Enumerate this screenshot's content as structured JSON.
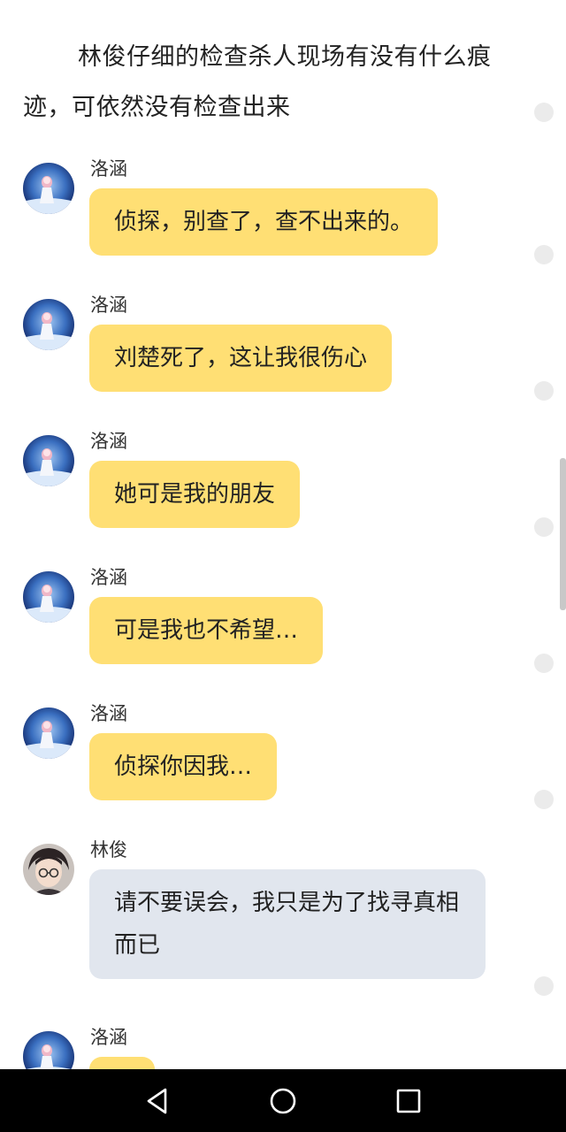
{
  "narration": {
    "text": "林俊仔细的检查杀人现场有没有什么痕迹，可依然没有检查出来"
  },
  "messages": [
    {
      "sender": "洛涵",
      "text": "侦探，别查了，查不出来的。",
      "style": "yellow",
      "avatar": "girl-avatar"
    },
    {
      "sender": "洛涵",
      "text": "刘楚死了，这让我很伤心",
      "style": "yellow",
      "avatar": "girl-avatar"
    },
    {
      "sender": "洛涵",
      "text": "她可是我的朋友",
      "style": "yellow",
      "avatar": "girl-avatar"
    },
    {
      "sender": "洛涵",
      "text": "可是我也不希望…",
      "style": "yellow",
      "avatar": "girl-avatar"
    },
    {
      "sender": "洛涵",
      "text": "侦探你因我…",
      "style": "yellow",
      "avatar": "girl-avatar"
    },
    {
      "sender": "林俊",
      "text": "请不要误会，我只是为了找寻真相而已",
      "style": "gray",
      "avatar": "boy-avatar"
    },
    {
      "sender": "洛涵",
      "text": "",
      "style": "yellow",
      "avatar": "girl-avatar"
    }
  ],
  "icons": {
    "back": "back-triangle-icon",
    "home": "home-circle-icon",
    "recents": "recents-square-icon"
  },
  "colors": {
    "yellow_bubble": "#ffdf74",
    "gray_bubble": "#e1e6ee",
    "navbar": "#000000"
  }
}
